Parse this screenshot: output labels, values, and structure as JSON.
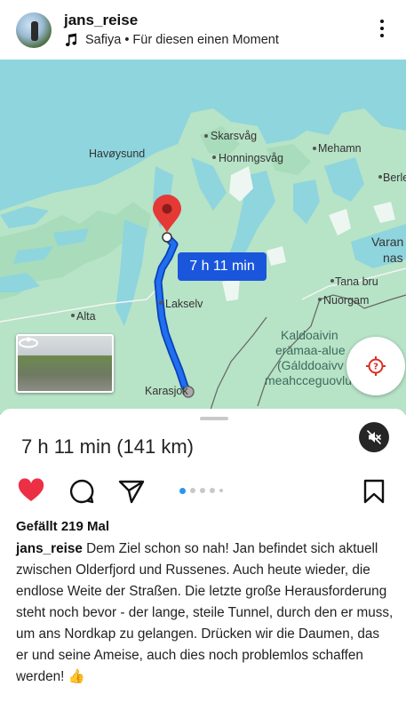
{
  "header": {
    "username": "jans_reise",
    "music": "Safiya • Für diesen einen Moment"
  },
  "map": {
    "labels": {
      "skarsvag": "Skarsvåg",
      "havoysund": "Havøysund",
      "honningsvag": "Honningsvåg",
      "mehamn": "Mehamn",
      "berlevag": "Berle",
      "varanger": "Varan",
      "varanger2": "nas",
      "tana_bru": "Tana bru",
      "nuorgam": "Nuorgam",
      "lakselv": "Lakselv",
      "alta": "Alta",
      "karasjok": "Karasjok",
      "kaldoaivi_1": "Kaldoaivin",
      "kaldoaivi_2": "erämaa-alue",
      "kaldoaivi_3": "(Gálddoaivv",
      "kaldoaivi_4": "meahcceguovlu"
    },
    "eta_badge": "7 h 11 min",
    "colors": {
      "water": "#8ed5de",
      "land": "#b7e3c7",
      "route": "#1a56db",
      "pin": "#e53935"
    }
  },
  "route": {
    "summary": "7 h 11 min (141 km)"
  },
  "post": {
    "likes": "Gefällt 219 Mal",
    "caption_user": "jans_reise",
    "caption_text": "Dem Ziel schon so nah! Jan befindet sich aktuell zwischen Olderfjord und Russenes. Auch heute wieder, die endlose Weite der Straßen. Die letzte große Herausforderung steht noch bevor - der lange, steile Tunnel, durch den er muss, um ans Nordkap zu gelangen. Drücken wir die Daumen, das er und seine Ameise, auch dies noch problemlos schaffen werden! 👍",
    "carousel_total": 6,
    "carousel_active": 1
  },
  "icons": {
    "more": "more-vert-icon",
    "music": "music-note-icon",
    "like": "heart-filled-icon",
    "comment": "comment-icon",
    "share": "send-icon",
    "save": "bookmark-icon",
    "mute": "speaker-muted-icon",
    "location": "location-target-icon",
    "streetview": "street-view-icon"
  }
}
